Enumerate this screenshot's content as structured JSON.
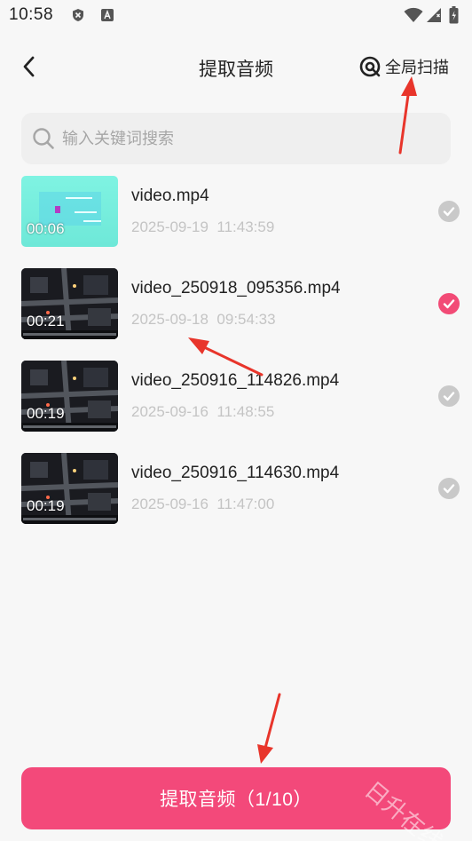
{
  "status_bar": {
    "time": "10:58",
    "icons": [
      "shield-icon",
      "a-icon",
      "wifi-icon",
      "signal-icon",
      "battery-icon"
    ]
  },
  "header": {
    "back_icon": "chevron-left-icon",
    "title": "提取音频",
    "scan_label": "全局扫描",
    "scan_icon": "scan-icon"
  },
  "search": {
    "placeholder": "输入关键词搜索",
    "icon": "search-icon"
  },
  "files": [
    {
      "name": "video.mp4",
      "date": "2025-09-19  11:43:59",
      "duration": "00:06",
      "selected": false,
      "thumb": "cyan"
    },
    {
      "name": "video_250918_095356.mp4",
      "date": "2025-09-18  09:54:33",
      "duration": "00:21",
      "selected": true,
      "thumb": "night"
    },
    {
      "name": "video_250916_114826.mp4",
      "date": "2025-09-16  11:48:55",
      "duration": "00:19",
      "selected": false,
      "thumb": "night"
    },
    {
      "name": "video_250916_114630.mp4",
      "date": "2025-09-16  11:47:00",
      "duration": "00:19",
      "selected": false,
      "thumb": "night"
    }
  ],
  "bottom": {
    "extract_label": "提取音频（1/10）"
  },
  "colors": {
    "accent": "#f3497a",
    "check_on": "#f24b76",
    "check_off": "#c9c9c9",
    "arrow": "#e8352b"
  },
  "watermark": "日升在线"
}
